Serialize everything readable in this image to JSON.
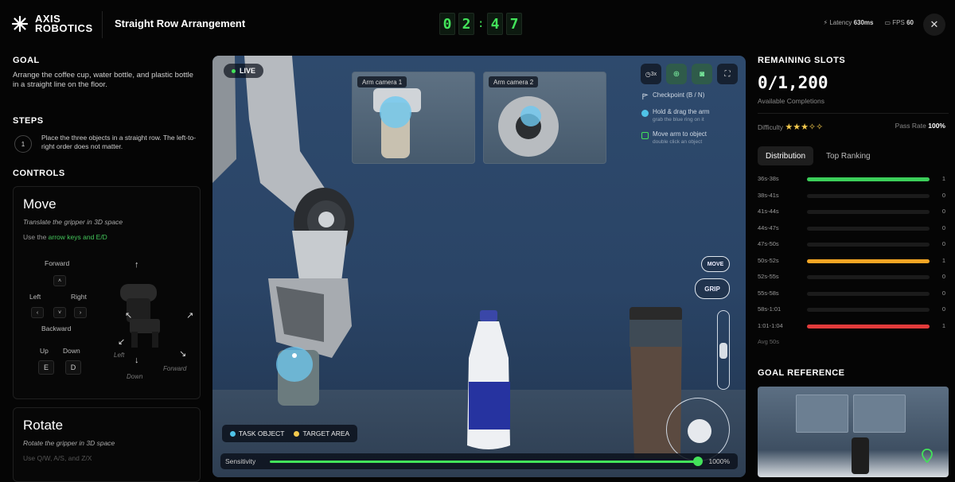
{
  "header": {
    "logo_line1": "AXIS",
    "logo_line2": "ROBOTICS",
    "task_title": "Straight Row Arrangement",
    "timer": [
      "0",
      "2",
      "4",
      "7"
    ],
    "latency_label": "Latency",
    "latency_value": "630ms",
    "fps_label": "FPS",
    "fps_value": "60",
    "close_icon": "close-icon"
  },
  "left": {
    "goal_title": "GOAL",
    "goal_text": "Arrange the coffee cup, water bottle, and plastic bottle in a straight line on the floor.",
    "steps_title": "STEPS",
    "step_number": "1",
    "step_text": "Place the three objects in a straight row. The left-to-right order does not matter.",
    "controls_title": "CONTROLS",
    "move": {
      "title": "Move",
      "subtitle": "Translate the gripper in 3D space",
      "hint_prefix": "Use the ",
      "hint_keys": "arrow keys and E/D",
      "forward": "Forward",
      "left": "Left",
      "right": "Right",
      "backward": "Backward",
      "up": "Up",
      "down": "Down",
      "key_up": "˄",
      "key_down": "˅",
      "key_left": "‹",
      "key_right": "›",
      "key_e": "E",
      "key_d": "D",
      "diagram_left": "Left",
      "diagram_down": "Down",
      "diagram_forward": "Forward"
    },
    "rotate": {
      "title": "Rotate",
      "subtitle": "Rotate the gripper in 3D space",
      "hint": "Use Q/W, A/S, and Z/X"
    }
  },
  "viewport": {
    "live_label": "LIVE",
    "arm_camera_1": "Arm camera 1",
    "arm_camera_2": "Arm camera 2",
    "tool_speed": "3x",
    "checkpoint": "Checkpoint (B / N)",
    "hold_drag_title": "Hold & drag the arm",
    "hold_drag_sub": "grab the blue ring on it",
    "move_to_obj_title": "Move arm to object",
    "move_to_obj_sub": "double click an object",
    "move_button": "MOVE",
    "grip_button": "GRIP",
    "legend_task": "TASK OBJECT",
    "legend_target": "TARGET AREA",
    "sensitivity_label": "Sensitivity",
    "sensitivity_value": "1000%",
    "sensitivity_fraction": 1.0,
    "colors": {
      "task_object": "#4fc3e8",
      "target_area": "#f3c94d",
      "accent": "#43e35a"
    }
  },
  "right": {
    "slots_title": "REMAINING SLOTS",
    "slots_value": "0/1,200",
    "slots_sub": "Available Completions",
    "difficulty_label": "Difficulty",
    "difficulty_stars": "★★★✧✧",
    "pass_rate_label": "Pass Rate",
    "pass_rate_value": "100%",
    "tab_distribution": "Distribution",
    "tab_top_ranking": "Top Ranking",
    "distribution": [
      {
        "label": "36s-38s",
        "count": "1",
        "fraction": 1.0,
        "color": "#3ccf5a"
      },
      {
        "label": "38s-41s",
        "count": "0",
        "fraction": 0,
        "color": "#3ccf5a"
      },
      {
        "label": "41s-44s",
        "count": "0",
        "fraction": 0,
        "color": "#3ccf5a"
      },
      {
        "label": "44s-47s",
        "count": "0",
        "fraction": 0,
        "color": "#3ccf5a"
      },
      {
        "label": "47s-50s",
        "count": "0",
        "fraction": 0,
        "color": "#3ccf5a"
      },
      {
        "label": "50s-52s",
        "count": "1",
        "fraction": 1.0,
        "color": "#f3a524"
      },
      {
        "label": "52s-55s",
        "count": "0",
        "fraction": 0,
        "color": "#3ccf5a"
      },
      {
        "label": "55s-58s",
        "count": "0",
        "fraction": 0,
        "color": "#3ccf5a"
      },
      {
        "label": "58s-1:01",
        "count": "0",
        "fraction": 0,
        "color": "#3ccf5a"
      },
      {
        "label": "1:01-1:04",
        "count": "1",
        "fraction": 1.0,
        "color": "#e23b3b"
      }
    ],
    "avg_label": "Avg 50s",
    "goal_reference_title": "GOAL REFERENCE"
  }
}
